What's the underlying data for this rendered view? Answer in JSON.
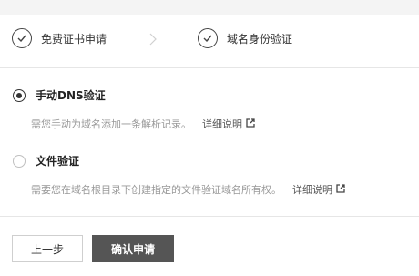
{
  "steps": [
    {
      "label": "免费证书申请",
      "state": "done"
    },
    {
      "label": "域名身份验证",
      "state": "done"
    }
  ],
  "options": [
    {
      "label": "手动DNS验证",
      "checked": true,
      "description": "需您手动为域名添加一条解析记录。",
      "link": "详细说明"
    },
    {
      "label": "文件验证",
      "checked": false,
      "description": "需要您在域名根目录下创建指定的文件验证域名所有权。",
      "link": "详细说明"
    }
  ],
  "buttons": {
    "prev": "上一步",
    "confirm": "确认申请"
  },
  "colors": {
    "confirm_bg": "#555555",
    "muted_text": "#999999"
  }
}
